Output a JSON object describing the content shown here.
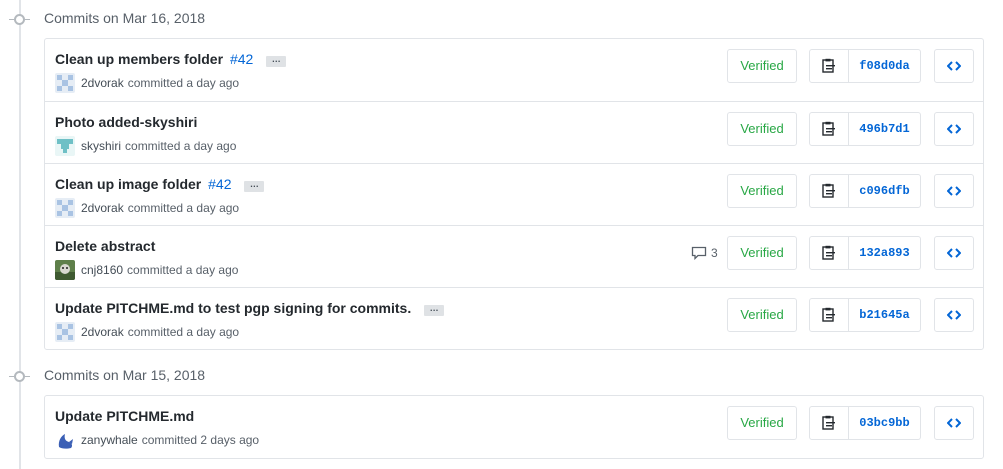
{
  "groups": [
    {
      "title": "Commits on Mar 16, 2018",
      "commits": [
        {
          "message": "Clean up members folder",
          "issue": "#42",
          "has_ellipsis": true,
          "author": "2dvorak",
          "when": "committed a day ago",
          "verified": "Verified",
          "sha": "f08d0da",
          "comments": null
        },
        {
          "message": "Photo added-skyshiri",
          "issue": "",
          "has_ellipsis": false,
          "author": "skyshiri",
          "when": "committed a day ago",
          "verified": "Verified",
          "sha": "496b7d1",
          "comments": null
        },
        {
          "message": "Clean up image folder",
          "issue": "#42",
          "has_ellipsis": true,
          "author": "2dvorak",
          "when": "committed a day ago",
          "verified": "Verified",
          "sha": "c096dfb",
          "comments": null
        },
        {
          "message": "Delete abstract",
          "issue": "",
          "has_ellipsis": false,
          "author": "cnj8160",
          "when": "committed a day ago",
          "verified": "Verified",
          "sha": "132a893",
          "comments": "3"
        },
        {
          "message": "Update PITCHME.md to test pgp signing for commits.",
          "issue": "",
          "has_ellipsis": true,
          "author": "2dvorak",
          "when": "committed a day ago",
          "verified": "Verified",
          "sha": "b21645a",
          "comments": null
        }
      ]
    },
    {
      "title": "Commits on Mar 15, 2018",
      "commits": [
        {
          "message": "Update PITCHME.md",
          "issue": "",
          "has_ellipsis": false,
          "author": "zanywhale",
          "when": "committed 2 days ago",
          "verified": "Verified",
          "sha": "03bc9bb",
          "comments": null
        }
      ]
    }
  ],
  "ellipsis_text": "…",
  "icons": {
    "clipboard": "clipboard-icon",
    "browse": "code-icon",
    "comment": "comment-icon"
  },
  "colors": {
    "link": "#0366d6",
    "verified": "#28a745",
    "border": "#e1e4e8",
    "muted": "#586069"
  }
}
